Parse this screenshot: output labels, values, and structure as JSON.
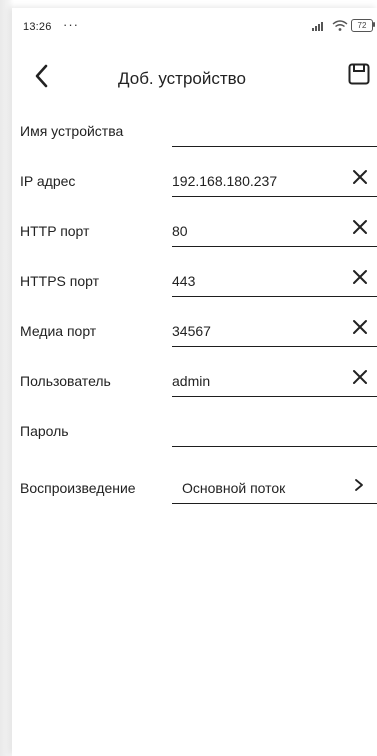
{
  "status_bar": {
    "time": "13:26",
    "dots": "···",
    "battery": "72"
  },
  "header": {
    "title": "Доб. устройство",
    "back_icon": "chevron-left-icon",
    "save_icon": "floppy-disk-icon"
  },
  "form": {
    "fields": [
      {
        "label": "Имя устройства",
        "value": ""
      },
      {
        "label": "IP адрес",
        "value": "192.168.180.237"
      },
      {
        "label": "HTTP порт",
        "value": "80"
      },
      {
        "label": "HTTPS порт",
        "value": "443"
      },
      {
        "label": "Медиа порт",
        "value": "34567"
      },
      {
        "label": "Пользователь",
        "value": "admin"
      },
      {
        "label": "Пароль",
        "value": ""
      }
    ],
    "playback": {
      "label": "Воспроизведение",
      "value": "Основной поток"
    }
  }
}
